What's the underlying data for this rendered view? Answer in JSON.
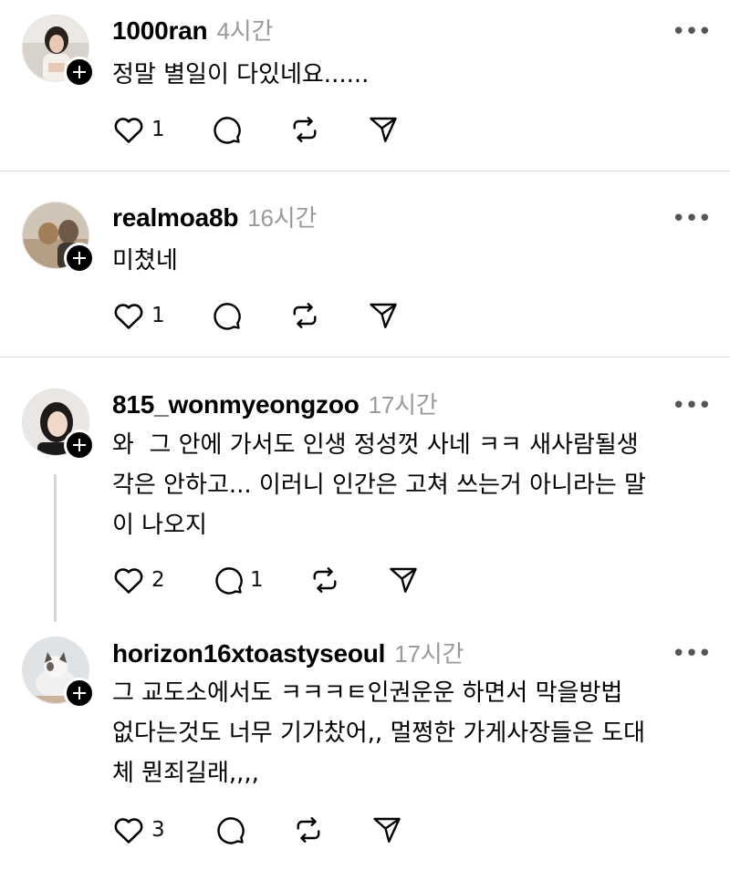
{
  "posts": [
    {
      "username": "1000ran",
      "time": "4시간",
      "text": "정말 별일이 다있네요......",
      "likes": "1",
      "replies": ""
    },
    {
      "username": "realmoa8b",
      "time": "16시간",
      "text": "미쳤네",
      "likes": "1",
      "replies": ""
    },
    {
      "username": "815_wonmyeongzoo",
      "time": "17시간",
      "text": "와  그 안에 가서도 인생 정성껏 사네 ㅋㅋ 새사람될생\n각은 안하고... 이러니 인간은 고쳐 쓰는거 아니라는 말\n이 나오지",
      "likes": "2",
      "replies": "1"
    },
    {
      "username": "horizon16xtoastyseoul",
      "time": "17시간",
      "text": "그 교도소에서도 ㅋㅋㅋㅌ인권운운 하면서 막을방법\n없다는것도 너무 기가찼어,, 멀쩡한 가게사장들은 도대\n체 뭔죄길래,,,,",
      "likes": "3",
      "replies": ""
    }
  ],
  "icons": {
    "like": "heart-icon",
    "reply": "comment-icon",
    "repost": "repost-icon",
    "share": "send-icon",
    "more": "more-icon",
    "follow": "plus-icon"
  },
  "more_glyph": "•••"
}
